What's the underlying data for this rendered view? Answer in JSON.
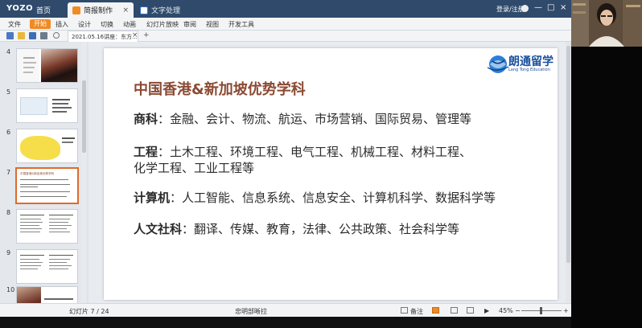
{
  "titlebar": {
    "logo": "YOZO",
    "home": "首页",
    "tabs": [
      {
        "label": "简报制作",
        "close": "×"
      },
      {
        "label": "文字处理"
      }
    ],
    "login": "登录/注册",
    "window_controls": [
      "—",
      "□",
      "×"
    ]
  },
  "menu": {
    "items": [
      "文件",
      "开始",
      "插入",
      "设计",
      "切换",
      "动画",
      "幻灯片放映",
      "审阅",
      "视图",
      "开发工具"
    ],
    "active": "开始"
  },
  "quickbar": {
    "doc_tab": "2021.05.16讲座：东方...",
    "close": "×",
    "plus": "+"
  },
  "thumbnails": {
    "numbers": [
      "4",
      "5",
      "6",
      "7",
      "8",
      "9",
      "10"
    ],
    "selected": "7",
    "thumb7_title": "中国香港&新加坡优势学科"
  },
  "slide": {
    "title": "中国香港&新加坡优势学科",
    "logo_cn": "朗通留学",
    "logo_en": "Lang Tong Education",
    "lines": [
      {
        "label": "商科",
        "sep": "：",
        "text": "金融、会计、物流、航运、市场营销、国际贸易、管理等"
      },
      {
        "label": "工程",
        "sep": "：",
        "text": "土木工程、环境工程、电气工程、机械工程、材料工程、"
      },
      {
        "label": "",
        "sep": "",
        "text": "化学工程、工业工程等"
      },
      {
        "label": "计算机",
        "sep": "：",
        "text": "人工智能、信息系统、信息安全、计算机科学、数据科学等"
      },
      {
        "label": "人文社科",
        "sep": "：",
        "text": "翻译、传媒、教育，法律、公共政策、社会科学等"
      }
    ]
  },
  "status": {
    "slide_counter": "幻灯片 7 / 24",
    "theme": "忠明部晰拉",
    "notes": "备注",
    "zoom": "45%"
  },
  "colors": {
    "titlebar": "#2f4a6b",
    "accent": "#f08a24",
    "slide_title": "#8a4a33",
    "selected_border": "#e06a2b",
    "logo_blue": "#1b4f9c"
  }
}
